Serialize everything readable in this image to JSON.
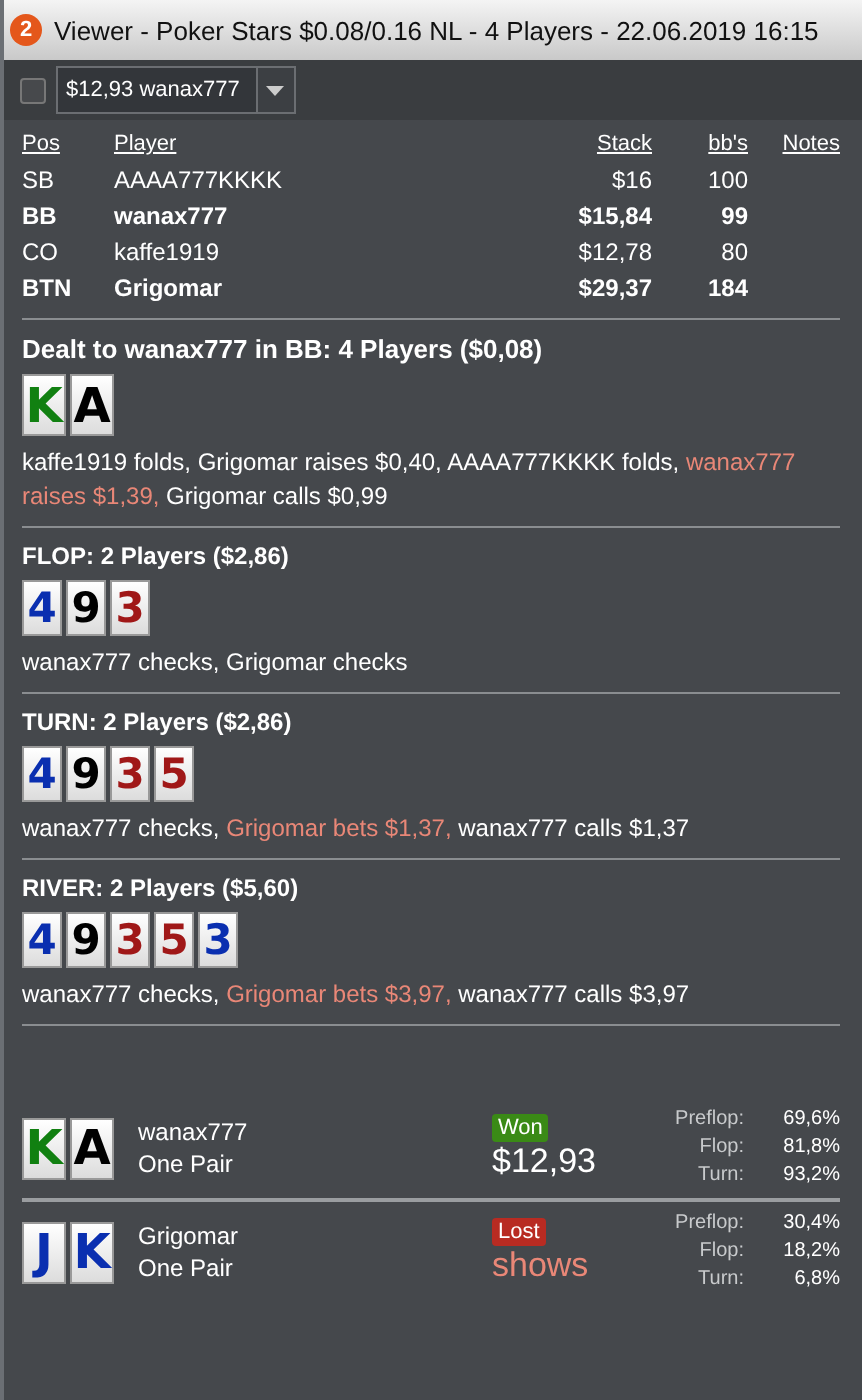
{
  "window": {
    "title": "Viewer - Poker Stars $0.08/0.16 NL - 4 Players - 22.06.2019 16:15",
    "badge": "2"
  },
  "toolbar": {
    "checkbox": {
      "checked": false
    },
    "hand_select": {
      "value": "$12,93 wanax777"
    }
  },
  "players": {
    "columns": [
      "Pos",
      "Player",
      "Stack",
      "bb's",
      "Notes"
    ],
    "rows": [
      {
        "pos": "SB",
        "player": "AAAA777KKKK",
        "stack": "$16",
        "bbs": "100",
        "hero_or_showdown": false
      },
      {
        "pos": "BB",
        "player": "wanax777",
        "stack": "$15,84",
        "bbs": "99",
        "hero_or_showdown": true
      },
      {
        "pos": "CO",
        "player": "kaffe1919",
        "stack": "$12,78",
        "bbs": "80",
        "hero_or_showdown": false
      },
      {
        "pos": "BTN",
        "player": "Grigomar",
        "stack": "$29,37",
        "bbs": "184",
        "hero_or_showdown": true
      }
    ]
  },
  "streets": [
    {
      "title": "Dealt to wanax777 in BB: 4 Players ($0,08)",
      "kind": "large",
      "cards": [
        {
          "rank": "K",
          "color": "#118011"
        },
        {
          "rank": "A",
          "color": "#000000"
        }
      ],
      "actions": [
        {
          "text": "kaffe1919 folds, Grigomar raises $0,40, AAAA777KKKK folds, ",
          "highlight": false
        },
        {
          "text": "wanax777 raises $1,39,",
          "highlight": true
        },
        {
          "text": " Grigomar calls $0,99",
          "highlight": false
        }
      ]
    },
    {
      "title": "FLOP: 2 Players ($2,86)",
      "kind": "small",
      "cards": [
        {
          "rank": "4",
          "color": "#0a2fb0"
        },
        {
          "rank": "9",
          "color": "#000000"
        },
        {
          "rank": "3",
          "color": "#a01818"
        }
      ],
      "actions": [
        {
          "text": "wanax777 checks, Grigomar checks",
          "highlight": false
        }
      ]
    },
    {
      "title": "TURN: 2 Players ($2,86)",
      "kind": "small",
      "cards": [
        {
          "rank": "4",
          "color": "#0a2fb0"
        },
        {
          "rank": "9",
          "color": "#000000"
        },
        {
          "rank": "3",
          "color": "#a01818"
        },
        {
          "rank": "5",
          "color": "#a01818"
        }
      ],
      "actions": [
        {
          "text": "wanax777 checks, ",
          "highlight": false
        },
        {
          "text": "Grigomar bets $1,37,",
          "highlight": true
        },
        {
          "text": " wanax777 calls $1,37",
          "highlight": false
        }
      ]
    },
    {
      "title": "RIVER: 2 Players ($5,60)",
      "kind": "small",
      "cards": [
        {
          "rank": "4",
          "color": "#0a2fb0"
        },
        {
          "rank": "9",
          "color": "#000000"
        },
        {
          "rank": "3",
          "color": "#a01818"
        },
        {
          "rank": "5",
          "color": "#a01818"
        },
        {
          "rank": "3",
          "color": "#0a2fb0"
        }
      ],
      "actions": [
        {
          "text": "wanax777 checks, ",
          "highlight": false
        },
        {
          "text": "Grigomar bets $3,97,",
          "highlight": true
        },
        {
          "text": " wanax777 calls $3,97",
          "highlight": false
        }
      ]
    }
  ],
  "results": [
    {
      "player": "wanax777",
      "hand": "One Pair",
      "won": true,
      "badge": "Won",
      "amount": "$12,93",
      "cards": [
        {
          "rank": "K",
          "color": "#118011"
        },
        {
          "rank": "A",
          "color": "#000000"
        }
      ],
      "equity": [
        {
          "label": "Preflop:",
          "value": "69,6%"
        },
        {
          "label": "Flop:",
          "value": "81,8%"
        },
        {
          "label": "Turn:",
          "value": "93,2%"
        }
      ]
    },
    {
      "player": "Grigomar",
      "hand": "One Pair",
      "won": false,
      "badge": "Lost",
      "amount": "shows",
      "cards": [
        {
          "rank": "J",
          "color": "#0a2fb0"
        },
        {
          "rank": "K",
          "color": "#0a2fb0"
        }
      ],
      "equity": [
        {
          "label": "Preflop:",
          "value": "30,4%"
        },
        {
          "label": "Flop:",
          "value": "18,2%"
        },
        {
          "label": "Turn:",
          "value": "6,8%"
        }
      ]
    }
  ]
}
